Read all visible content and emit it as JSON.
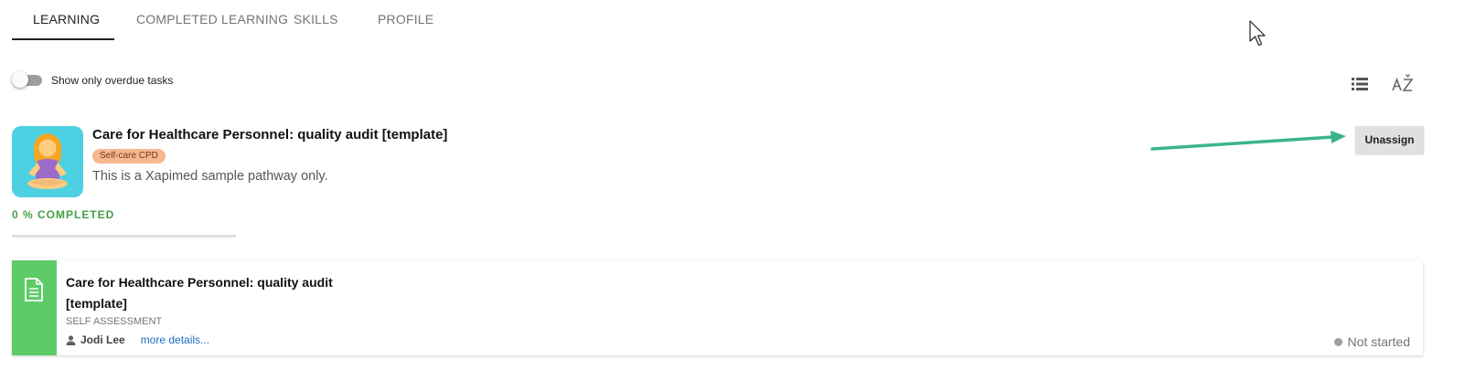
{
  "tabs": [
    {
      "label": "LEARNING",
      "active": true
    },
    {
      "label": "COMPLETED LEARNING",
      "active": false
    },
    {
      "label": "SKILLS",
      "active": false
    },
    {
      "label": "PROFILE",
      "active": false
    }
  ],
  "filter": {
    "overdue_toggle_label": "Show only overdue tasks",
    "overdue_toggle_on": false
  },
  "toolbar": {
    "list_view_icon": "list-view-icon",
    "sort_icon": "sort-az-icon"
  },
  "pathway": {
    "title": "Care for Healthcare Personnel: quality audit [template]",
    "badge": "Self-care CPD",
    "description": "This is a Xapimed sample pathway only.",
    "icon": "meditating-person-icon",
    "progress_label": "0 % COMPLETED",
    "progress_percent": 0,
    "unassign_label": "Unassign"
  },
  "activity": {
    "title_line1": "Care for Healthcare Personnel: quality audit",
    "title_line2": "[template]",
    "type": "SELF ASSESSMENT",
    "author": "Jodi Lee",
    "more_link": "more details...",
    "status": "Not started",
    "icon": "document-icon"
  },
  "colors": {
    "accent_green": "#43a047",
    "card_strip": "#5ccb68",
    "icon_bg": "#4dd0e1",
    "badge_bg": "#f7b78f",
    "arrow": "#3cb38f",
    "link": "#1e6fc4"
  }
}
